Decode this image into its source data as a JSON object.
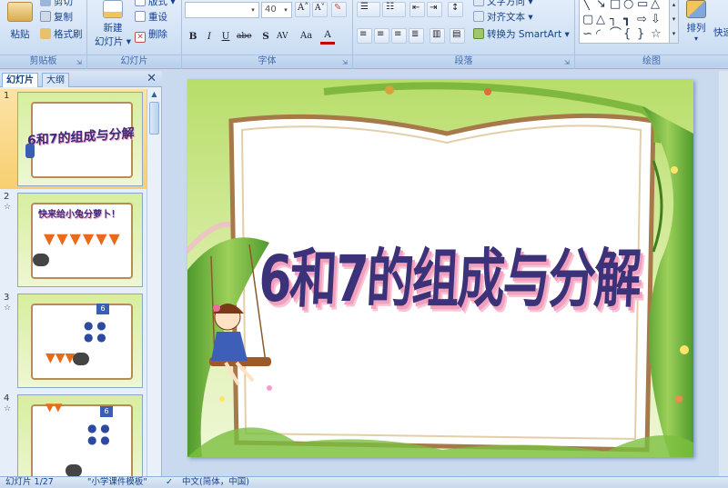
{
  "ribbon": {
    "clipboard": {
      "paste_label": "粘贴",
      "cut_label": "剪切",
      "copy_label": "复制",
      "format_painter_label": "格式刷",
      "group_label": "剪贴板"
    },
    "slides": {
      "new_slide_label_1": "新建",
      "new_slide_label_2": "幻灯片 ▾",
      "layout_label": "版式 ▾",
      "reset_label": "重设",
      "delete_label": "删除",
      "group_label": "幻灯片"
    },
    "font": {
      "font_name_value": "",
      "font_size_value": "40",
      "group_label": "字体",
      "bold": "B",
      "italic": "I",
      "underline": "U",
      "strike": "abe",
      "shadow": "S",
      "spacing": "AV",
      "case": "Aa",
      "color": "A"
    },
    "paragraph": {
      "text_direction_label": "文字方向 ▾",
      "align_text_label": "对齐文本 ▾",
      "smartart_label": "转换为 SmartArt ▾",
      "group_label": "段落"
    },
    "drawing": {
      "arrange_label": "排列",
      "quick_styles_label": "快速",
      "group_label": "绘图"
    }
  },
  "pane": {
    "tab_slides": "幻灯片",
    "tab_outline": "大纲",
    "close_glyph": "✕",
    "slides": [
      {
        "number": "1",
        "title": "6和7的组成与分解"
      },
      {
        "number": "2",
        "title": "快来给小兔分萝卜！"
      },
      {
        "number": "3",
        "title": "6"
      },
      {
        "number": "4",
        "title": "6"
      }
    ]
  },
  "slide": {
    "title": "6和7的组成与分解"
  },
  "status": {
    "slide_counter": "幻灯片 1/27",
    "theme_name": "\"小学课件模板\"",
    "language": "中文(简体，中国)"
  },
  "colors": {
    "title_fill": "#3b3279",
    "title_shadow": "#f2a0bd",
    "frame": "#a6794a",
    "vine": "#6fae3a",
    "background_green": "#cfe89a"
  }
}
